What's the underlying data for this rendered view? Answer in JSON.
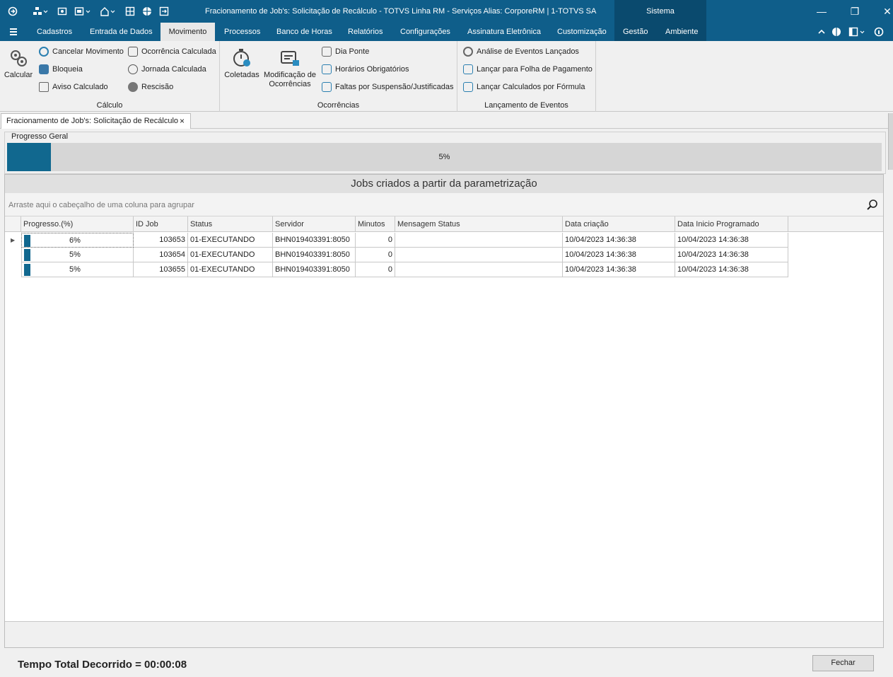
{
  "window": {
    "title": "Fracionamento de Job's: Solicitação de Recálculo - TOTVS Linha RM - Serviços  Alias: CorporeRM | 1-TOTVS SA",
    "sistema_label": "Sistema"
  },
  "menu": {
    "items": [
      "Cadastros",
      "Entrada de Dados",
      "Movimento",
      "Processos",
      "Banco de Horas",
      "Relatórios",
      "Configurações",
      "Assinatura Eletrônica",
      "Customização",
      "Gestão",
      "Ambiente"
    ],
    "active": "Movimento"
  },
  "ribbon": {
    "calculo": {
      "label": "Cálculo",
      "calcular": "Calcular",
      "cancelar_movimento": "Cancelar Movimento",
      "bloqueia": "Bloqueia",
      "aviso_calculado": "Aviso Calculado",
      "ocorrencia_calculada": "Ocorrência Calculada",
      "jornada_calculada": "Jornada Calculada",
      "rescisao": "Rescisão"
    },
    "ocorrencias": {
      "label": "Ocorrências",
      "coletadas": "Coletadas",
      "modificacao_1": "Modificação de",
      "modificacao_2": "Ocorrências",
      "dia_ponte": "Dia Ponte",
      "horarios_obrigatorios": "Horários Obrigatórios",
      "faltas_suspensao": "Faltas por Suspensão/Justificadas"
    },
    "lancamento": {
      "label": "Lançamento de Eventos",
      "analise_eventos": "Análise de Eventos Lançados",
      "lancar_folha": "Lançar para Folha de Pagamento",
      "lancar_formula": "Lançar Calculados por Fórmula"
    }
  },
  "document_tab": {
    "label": "Fracionamento de Job's: Solicitação de Recálculo",
    "close": "×"
  },
  "progress": {
    "legend": "Progresso Geral",
    "value_pct": 5,
    "text": "5%"
  },
  "panel": {
    "title": "Jobs criados a partir da parametrização",
    "group_placeholder": "Arraste aqui o cabeçalho de uma coluna para agrupar"
  },
  "grid": {
    "columns": [
      "Progresso.(%)",
      "ID Job",
      "Status",
      "Servidor",
      "Minutos",
      "Mensagem Status",
      "Data criação",
      "Data Inicio Programado"
    ],
    "rows": [
      {
        "progress": "6%",
        "id": "103653",
        "status": "01-EXECUTANDO",
        "server": "BHN019403391:8050",
        "minutes": "0",
        "message": "",
        "created": "10/04/2023 14:36:38",
        "start": "10/04/2023 14:36:38"
      },
      {
        "progress": "5%",
        "id": "103654",
        "status": "01-EXECUTANDO",
        "server": "BHN019403391:8050",
        "minutes": "0",
        "message": "",
        "created": "10/04/2023 14:36:38",
        "start": "10/04/2023 14:36:38"
      },
      {
        "progress": "5%",
        "id": "103655",
        "status": "01-EXECUTANDO",
        "server": "BHN019403391:8050",
        "minutes": "0",
        "message": "",
        "created": "10/04/2023 14:36:38",
        "start": "10/04/2023 14:36:38"
      }
    ]
  },
  "footer": {
    "elapsed": "Tempo Total Decorrido = 00:00:08",
    "close_button": "Fechar"
  },
  "colors": {
    "brand": "#0f5e8a",
    "progress_fill": "#11688f"
  }
}
